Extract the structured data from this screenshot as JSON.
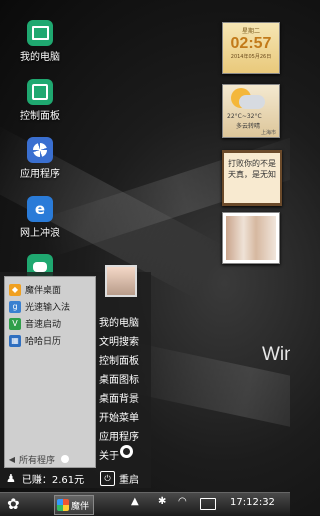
{
  "desktop": {
    "icons": [
      {
        "label": "我的电脑",
        "icon": "computer-icon",
        "color": "#1fa870"
      },
      {
        "label": "控制面板",
        "icon": "control-panel-icon",
        "color": "#1fa870"
      },
      {
        "label": "应用程序",
        "icon": "apps-icon",
        "color": "#3a6fd0"
      },
      {
        "label": "网上冲浪",
        "icon": "browser-icon",
        "color": "#2a7bd8"
      },
      {
        "label": "",
        "icon": "chat-icon",
        "color": "#1fa870"
      }
    ],
    "watermark": "Win"
  },
  "widgets": {
    "clock": {
      "weekday": "星期二",
      "time": "02:57",
      "date": "2014年05月26日"
    },
    "weather": {
      "temp": "22°C~32°C",
      "condition": "多云转晴",
      "city": "上海市"
    },
    "note": {
      "line1": "打败你的不是",
      "line2": "天真，是无知"
    },
    "photo": {
      "icon": "photo-icon"
    }
  },
  "start_menu": {
    "programs": [
      {
        "label": "魔伴桌面",
        "icon": "mobanzhuomian-icon",
        "color": "#f0a020"
      },
      {
        "label": "光速输入法",
        "icon": "input-method-icon",
        "color": "#3a80d0"
      },
      {
        "label": "音速启动",
        "icon": "quick-launch-icon",
        "color": "#2f9f4a"
      },
      {
        "label": "哈哈日历",
        "icon": "calendar-icon",
        "color": "#2f6fc0"
      }
    ],
    "all_programs": "所有程序",
    "right_items": [
      "我的电脑",
      "文明搜索",
      "控制面板",
      "桌面图标",
      "桌面背景",
      "开始菜单",
      "应用程序",
      "关于"
    ],
    "earned": "已赚：2.61元",
    "restart": "重启"
  },
  "taskbar": {
    "task_label": "魔伴",
    "clock": "17:12:32",
    "tray_icons": [
      "up-arrow-icon",
      "bluetooth-icon",
      "wifi-icon",
      "battery-icon"
    ]
  }
}
